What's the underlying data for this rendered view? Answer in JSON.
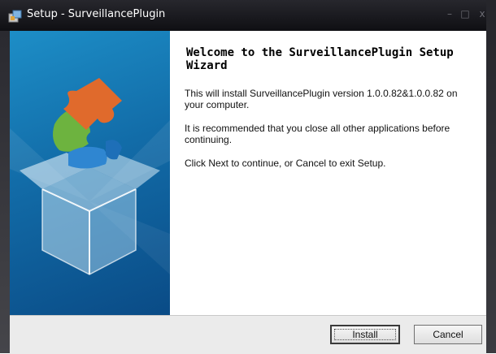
{
  "window": {
    "title": "Setup - SurveillancePlugin"
  },
  "titlebar_buttons": {
    "minimize": "–",
    "maximize": "□",
    "close": "x"
  },
  "content": {
    "heading_line1": "Welcome to the SurveillancePlugin Setup",
    "heading_line2": "Wizard",
    "paragraph1": "This will install SurveillancePlugin version 1.0.0.82&1.0.0.82 on your computer.",
    "paragraph2": "It is recommended that you close all other applications before continuing.",
    "paragraph3": "Click Next to continue, or Cancel to exit Setup."
  },
  "buttons": {
    "install": "Install",
    "cancel": "Cancel"
  },
  "icons": {
    "app": "setup-icon",
    "wizard_image": "puzzle-box-graphic"
  },
  "colors": {
    "titlebar": "#1a1a1f",
    "panel": "#126ca8",
    "footer": "#ebebeb"
  }
}
